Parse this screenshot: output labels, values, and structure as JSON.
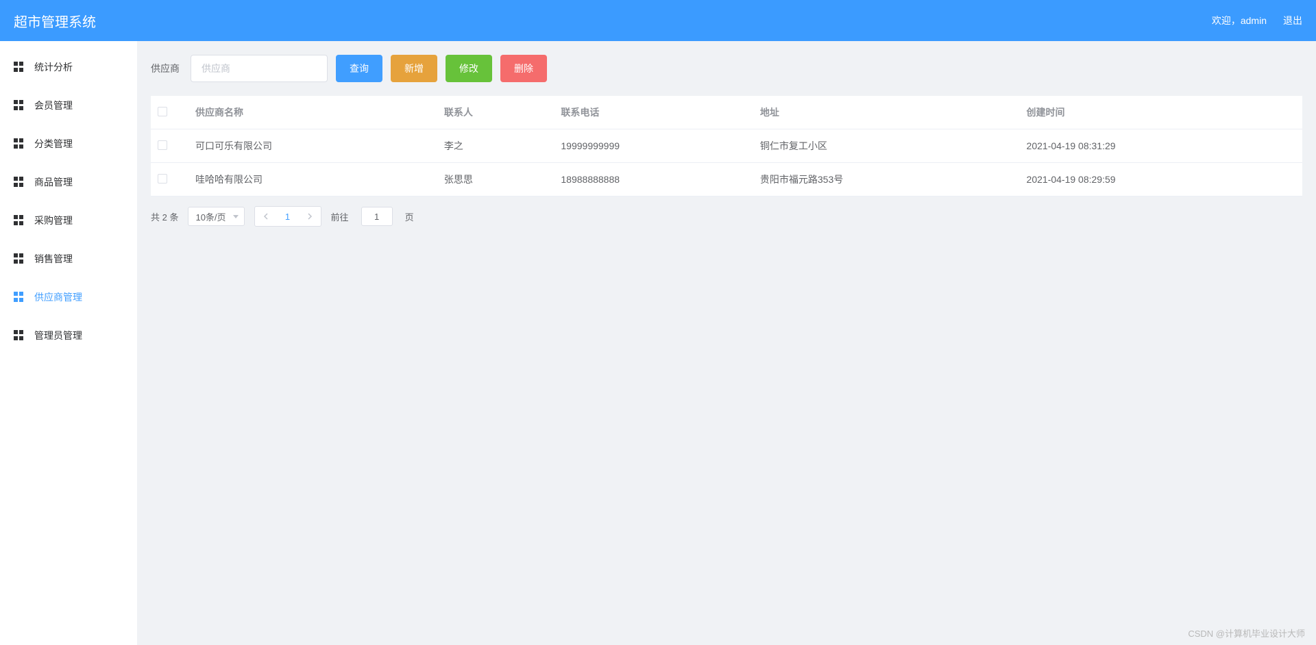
{
  "header": {
    "title": "超市管理系统",
    "welcome": "欢迎，admin",
    "logout": "退出"
  },
  "sidebar": {
    "items": [
      {
        "label": "统计分析",
        "active": false
      },
      {
        "label": "会员管理",
        "active": false
      },
      {
        "label": "分类管理",
        "active": false
      },
      {
        "label": "商品管理",
        "active": false
      },
      {
        "label": "采购管理",
        "active": false
      },
      {
        "label": "销售管理",
        "active": false
      },
      {
        "label": "供应商管理",
        "active": true
      },
      {
        "label": "管理员管理",
        "active": false
      }
    ]
  },
  "toolbar": {
    "search_label": "供应商",
    "search_placeholder": "供应商",
    "query_label": "查询",
    "add_label": "新增",
    "edit_label": "修改",
    "delete_label": "删除"
  },
  "table": {
    "headers": {
      "name": "供应商名称",
      "contact": "联系人",
      "phone": "联系电话",
      "address": "地址",
      "created": "创建时间"
    },
    "rows": [
      {
        "name": "可口可乐有限公司",
        "contact": "李之",
        "phone": "19999999999",
        "address": "铜仁市复工小区",
        "created": "2021-04-19 08:31:29"
      },
      {
        "name": "哇哈哈有限公司",
        "contact": "张思思",
        "phone": "18988888888",
        "address": "贵阳市福元路353号",
        "created": "2021-04-19 08:29:59"
      }
    ]
  },
  "pagination": {
    "total_text": "共 2 条",
    "page_size": "10条/页",
    "current_page": "1",
    "jump_prefix": "前往",
    "jump_value": "1",
    "jump_suffix": "页"
  },
  "watermark": "CSDN @计算机毕业设计大师"
}
